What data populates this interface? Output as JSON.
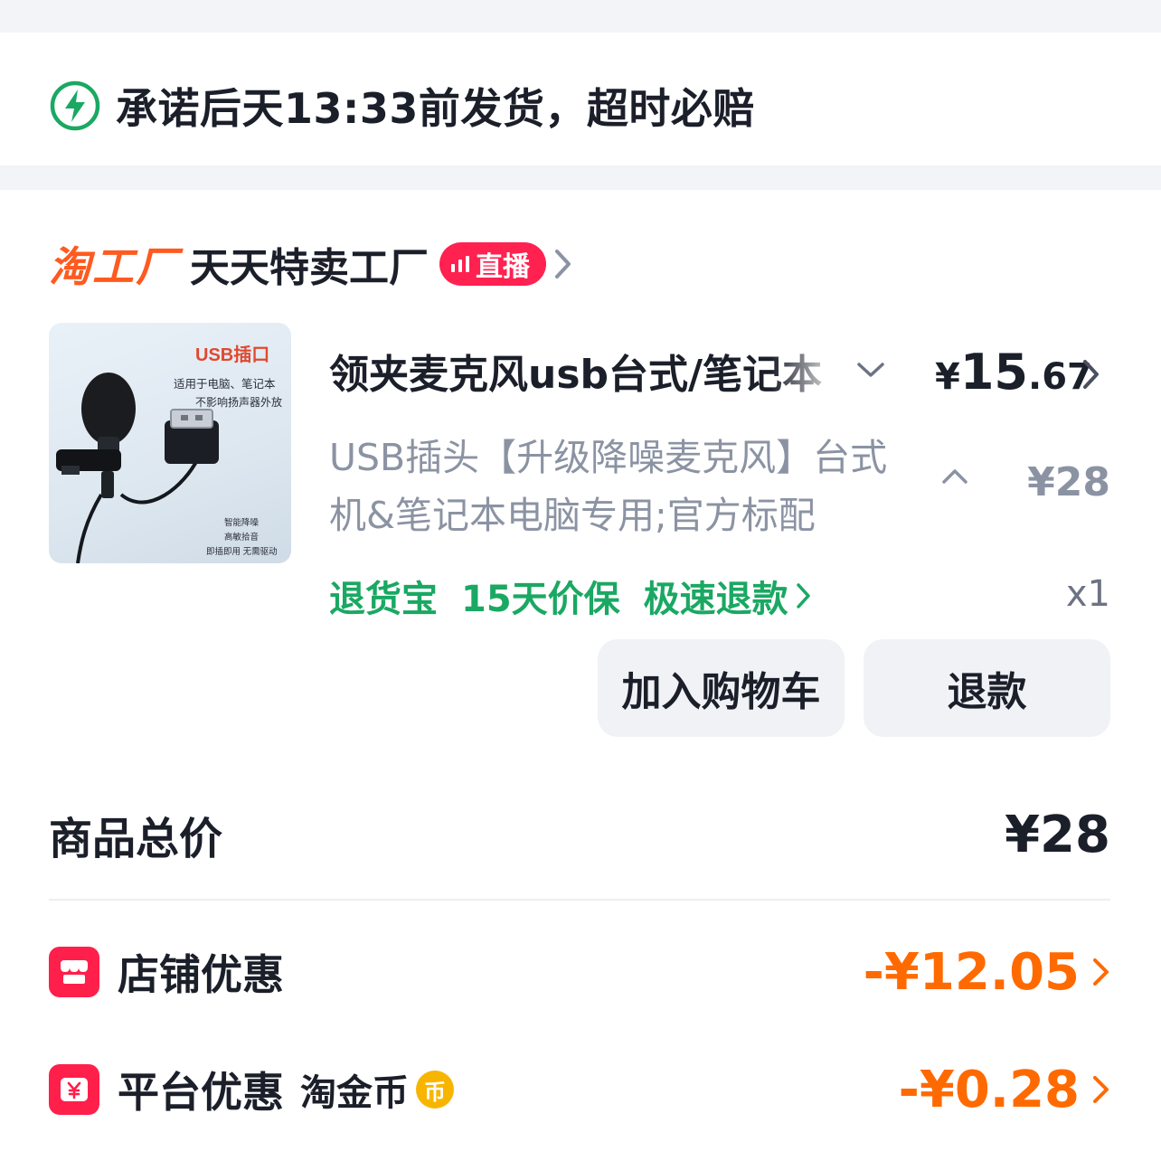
{
  "promise": {
    "text": "承诺后天13:33前发货，超时必赔",
    "icon": "lightning-icon"
  },
  "shop": {
    "logo": "淘工厂",
    "name": "天天特卖工厂",
    "live_label": "直播"
  },
  "product": {
    "image_text": {
      "headline": "USB插口",
      "line1": "适用于电脑、笔记本",
      "line2": "不影响扬声器外放",
      "foot1": "智能降噪",
      "foot2": "高敏拾音",
      "foot3": "即插即用 无需驱动"
    },
    "title": "领夹麦克风usb台式/笔记本",
    "price_symbol": "¥",
    "price_int": "15",
    "price_dec": ".67",
    "spec": "USB插头【升级降噪麦克风】台式机&笔记本电脑专用;官方标配",
    "original_price": "¥28",
    "services": [
      "退货宝",
      "15天价保",
      "极速退款"
    ],
    "quantity": "x1"
  },
  "buttons": {
    "add_to_cart": "加入购物车",
    "refund": "退款"
  },
  "summary": {
    "total_label": "商品总价",
    "total_value": "¥28",
    "shop_discount_label": "店铺优惠",
    "shop_discount_value": "-¥12.05",
    "platform_discount_label": "平台优惠",
    "platform_discount_sub": "淘金币",
    "coin_glyph": "币",
    "platform_discount_value": "-¥0.28"
  },
  "colors": {
    "accent_orange": "#ff6a00",
    "live_red": "#ff2150",
    "service_green": "#1aa862",
    "shop_logo": "#ff5a1f"
  }
}
